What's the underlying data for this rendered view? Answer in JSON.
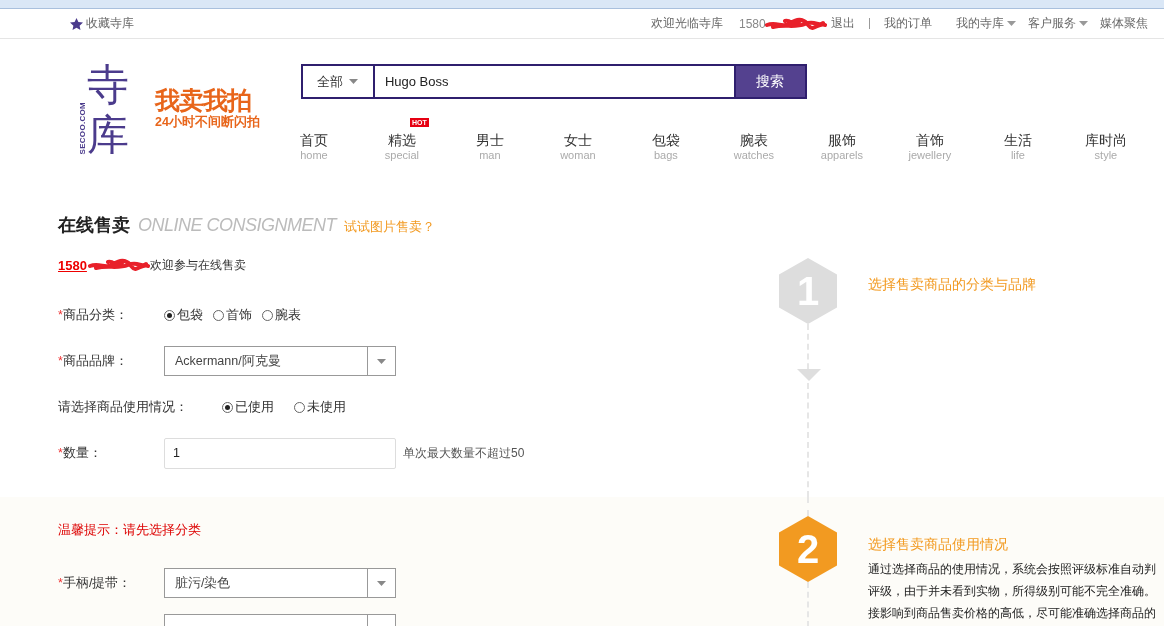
{
  "top_bar": {
    "favorite": "收藏寺库",
    "welcome": "欢迎光临寺库",
    "user": "1580",
    "links": [
      {
        "label": "退出",
        "dropdown": false,
        "divider": true
      },
      {
        "label": "我的订单",
        "dropdown": false,
        "divider": false
      },
      {
        "label": "我的寺库",
        "dropdown": true,
        "divider": false
      },
      {
        "label": "客户服务",
        "dropdown": true,
        "divider": false
      },
      {
        "label": "媒体聚焦",
        "dropdown": false,
        "divider": false
      }
    ]
  },
  "logo": {
    "mark": "寺库",
    "domain": "SECOO.COM",
    "slogan": "我卖我拍",
    "tagline": "24小时不间断闪拍"
  },
  "search": {
    "scope": "全部",
    "value": "Hugo Boss",
    "button": "搜索"
  },
  "nav": [
    {
      "label": "首页",
      "sub": "home"
    },
    {
      "label": "精选",
      "sub": "special",
      "badge": "HOT"
    },
    {
      "label": "男士",
      "sub": "man"
    },
    {
      "label": "女士",
      "sub": "woman"
    },
    {
      "label": "包袋",
      "sub": "bags"
    },
    {
      "label": "腕表",
      "sub": "watches"
    },
    {
      "label": "服饰",
      "sub": "apparels"
    },
    {
      "label": "首饰",
      "sub": "jewellery"
    },
    {
      "label": "生活",
      "sub": "life"
    },
    {
      "label": "库时尚",
      "sub": "style"
    }
  ],
  "page": {
    "title": "在线售卖",
    "subtitle": "ONLINE CONSIGNMENT",
    "link": "试试图片售卖？",
    "user": "1580",
    "greeting": "欢迎参与在线售卖"
  },
  "form": [
    {
      "kind": "radio",
      "asterisk": "*",
      "label": "商品分类：",
      "options": [
        {
          "label": "包袋",
          "selected": true
        },
        {
          "label": "首饰",
          "selected": false
        },
        {
          "label": "腕表",
          "selected": false
        }
      ]
    },
    {
      "kind": "select",
      "asterisk": "*",
      "label": "商品品牌：",
      "value": "Ackermann/阿克曼"
    },
    {
      "kind": "radio",
      "label": "请选择商品使用情况：",
      "options": [
        {
          "label": "已使用",
          "selected": true
        },
        {
          "label": "未使用",
          "selected": false
        }
      ]
    },
    {
      "kind": "input",
      "asterisk": "*",
      "label": "数量：",
      "value": "1",
      "note": "单次最大数量不超过50"
    }
  ],
  "steps": [
    {
      "number": "1",
      "active": false,
      "title": "选择售卖商品的分类与品牌"
    },
    {
      "number": "2",
      "active": true,
      "title": "选择售卖商品使用情况",
      "description": [
        "通过选择商品的使用情况，系统会按照评级标准自动判",
        "评级，由于并未看到实物，所得级别可能不完全准确。",
        "接影响到商品售卖价格的高低，尽可能准确选择商品的"
      ]
    }
  ],
  "condition": {
    "hint": "温馨提示：请先选择分类",
    "form": [
      {
        "kind": "select",
        "asterisk": "*",
        "label": "手柄/提带：",
        "value": "脏污/染色"
      },
      {
        "kind": "select"
      }
    ]
  }
}
